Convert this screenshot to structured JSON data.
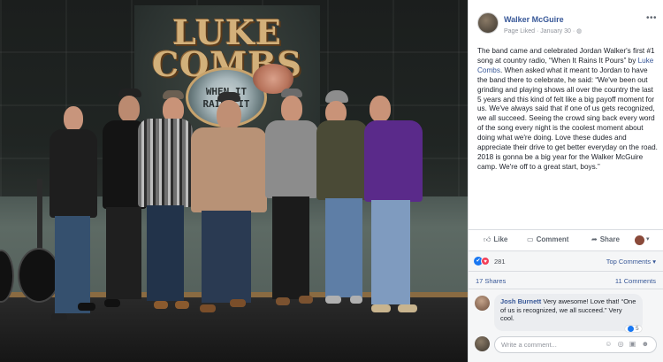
{
  "photo": {
    "backdrop_logo_line1": "LUKE",
    "backdrop_logo_line2": "COMBS",
    "record_line1": "WHEN IT",
    "record_line2": "RAINS IT"
  },
  "post": {
    "page_name": "Walker McGuire",
    "meta": "Page Liked · January 30 · ",
    "more_icon": "more-dots-icon",
    "text_part1": "The band came and celebrated Jordan Walker's first #1 song at country radio, “When It Rains It Pours” by ",
    "text_link": "Luke Combs",
    "text_part2": ". When asked what it meant to Jordan to have the band there to celebrate, he said: “We've been out grinding and playing shows all over the country the last 5 years and this kind of felt like a big payoff moment for us. We've always said that if one of us gets recognized, we all succeed. Seeing the crowd sing back every word of the song every night is the coolest moment about doing what we're doing. Love these dudes and appreciate their drive to get better everyday on the road. 2018 is gonna be a big year for the Walker McGuire camp. We're off to a great start, boys.”"
  },
  "actions": {
    "like": "Like",
    "comment": "Comment",
    "share": "Share"
  },
  "reactions": {
    "count": "281",
    "top_comments": "Top Comments ▾"
  },
  "stats": {
    "shares": "17 Shares",
    "comments": "11 Comments"
  },
  "comment": {
    "author": "Josh Burnett",
    "text": " Very awesome! Love that! “One of us is recognized, we all succeed.” Very cool.",
    "likes": "5"
  },
  "compose": {
    "placeholder": "Write a comment...",
    "icons": "☺ ◎ ▣ ☻"
  },
  "colors": {
    "link": "#385898",
    "like_blue": "#1877f2",
    "love_red": "#f33e58"
  }
}
